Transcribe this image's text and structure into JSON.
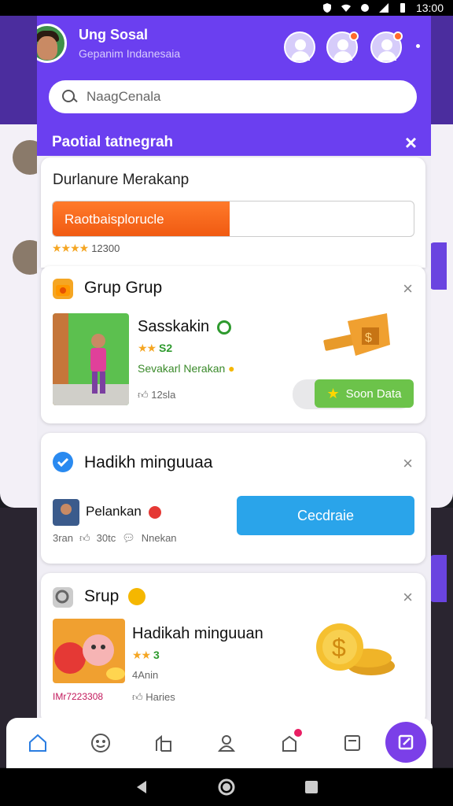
{
  "status_bar": {
    "time": "13:00"
  },
  "header": {
    "title": "Ung Sosal",
    "subtitle": "Gepanim Indanesaia",
    "accent": "#6b3ff0"
  },
  "search": {
    "placeholder": "NaagCenala"
  },
  "section": {
    "title": "Paotial tatnegrah"
  },
  "card_progress": {
    "title": "Durlanure Merakanp",
    "progress_label": "Raotbaisplorucle",
    "progress_value": 0.49,
    "rating_text": "12300"
  },
  "card_group": {
    "title": "Grup Grup",
    "item_title": "Sasskakin",
    "item_rating": "S2",
    "item_sub": "Sevakarl Nerakan",
    "item_meta": "12sla",
    "button_label": "Soon Data"
  },
  "card_weekly": {
    "title": "Hadikh minguuaa",
    "user_name": "Pelankan",
    "meta_1": "3ran",
    "meta_2": "30tc",
    "meta_3": "Nnekan",
    "button_label": "Cecdraie"
  },
  "card_grup2": {
    "title": "Srup",
    "item_title": "Hadikah minguuan",
    "item_rating": "3",
    "item_sub": "4Anin",
    "item_code": "IMr7223308",
    "item_meta": "Haries"
  },
  "icons": {
    "nav": [
      "home-icon",
      "smiley-icon",
      "building-icon",
      "person-icon",
      "notification-icon",
      "inbox-icon",
      "compose-icon"
    ]
  },
  "colors": {
    "progress": "#f05a12",
    "success": "#6cc34a",
    "primary_button": "#2aa4ea",
    "fab": "#7b3fe8"
  }
}
